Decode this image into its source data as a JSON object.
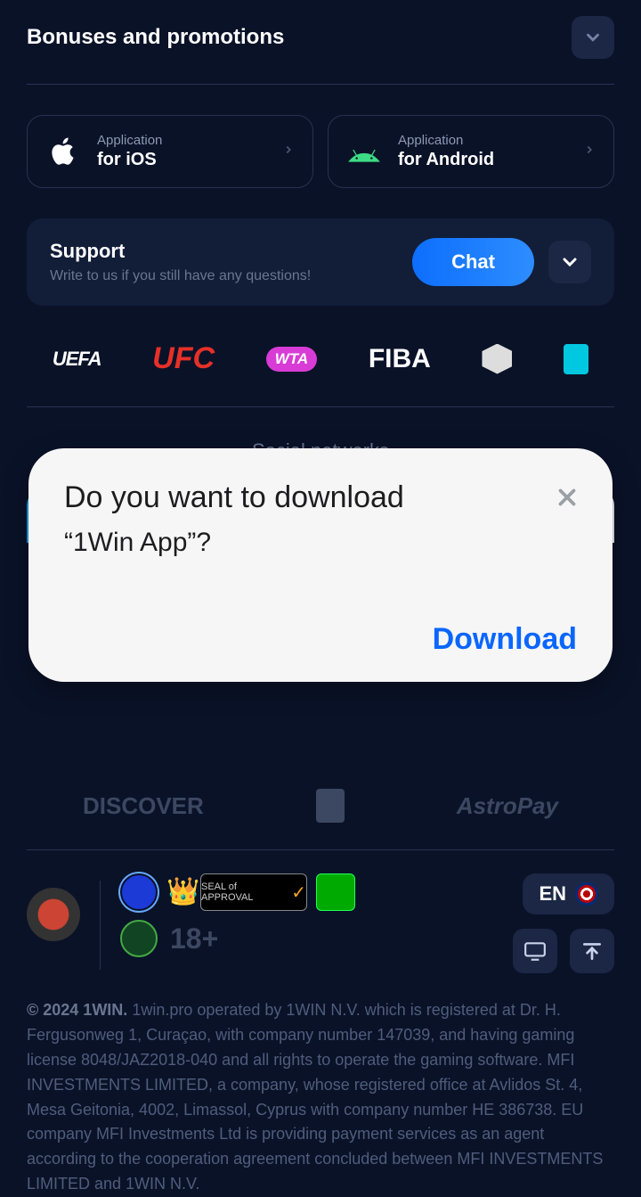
{
  "bonuses": {
    "title": "Bonuses and promotions"
  },
  "apps": {
    "ios": {
      "t1": "Application",
      "t2": "for iOS"
    },
    "android": {
      "t1": "Application",
      "t2": "for Android"
    }
  },
  "support": {
    "title": "Support",
    "sub": "Write to us if you still have any questions!",
    "chat": "Chat"
  },
  "partners": {
    "uefa": "UEFA",
    "ufc": "UFC",
    "wta": "WTA",
    "fiba": "FIBA"
  },
  "social": {
    "title": "Social networks"
  },
  "payments": {
    "discover": "DISCOVER",
    "astropay": "AstroPay"
  },
  "cert": {
    "seal": "SEAL of APPROVAL",
    "age": "18+"
  },
  "lang": {
    "code": "EN"
  },
  "legal": {
    "head": "© 2024 1WIN.",
    "text": " 1win.pro operated by 1WIN N.V. which is registered at Dr. H. Fergusonweg 1, Curaçao, with company number 147039, and having gaming license 8048/JAZ2018-040 and all rights to operate the gaming software. MFI INVESTMENTS LIMITED, a company, whose registered office at Avlidos St. 4, Mesa Geitonia, 4002, Limassol, Cyprus with company number HE 386738. EU company MFI Investments Ltd is providing payment services as an agent according to the cooperation agreement concluded between MFI INVESTMENTS LIMITED and 1WIN N.V."
  },
  "modal": {
    "title": "Do you want to download",
    "sub": "“1Win App”?",
    "download": "Download"
  }
}
